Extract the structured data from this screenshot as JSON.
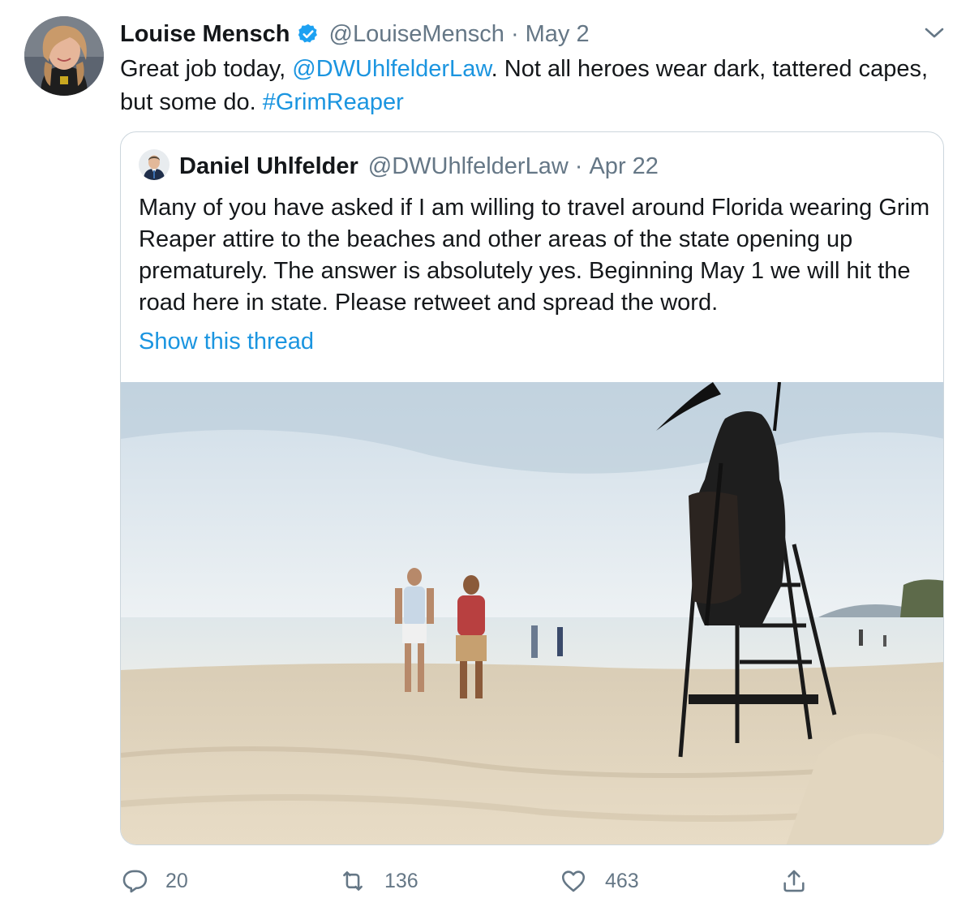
{
  "tweet": {
    "author": {
      "name": "Louise Mensch",
      "handle": "@LouiseMensch",
      "verified": true,
      "avatar_icon": "profile-photo"
    },
    "separator": "·",
    "date": "May 2",
    "text": {
      "part1": "Great job today, ",
      "mention": "@DWUhlfelderLaw",
      "part2": ". Not all heroes wear dark, tattered capes, but some do. ",
      "hashtag": "#GrimReaper"
    },
    "more_icon": "chevron-down-icon"
  },
  "quoted_tweet": {
    "author": {
      "name": "Daniel Uhlfelder",
      "handle": "@DWUhlfelderLaw",
      "avatar_icon": "profile-photo"
    },
    "separator": "·",
    "date": "Apr 22",
    "text": "Many of you have asked if I am willing to travel around Florida wearing Grim Reaper attire to the beaches and other areas of the state opening up prematurely. The answer is absolutely yes. Beginning May 1 we will hit the road here in state. Please retweet and spread the word.",
    "show_thread": "Show this thread",
    "media_icon": "beach-photo-grim-reaper"
  },
  "actions": {
    "reply": {
      "icon": "reply-icon",
      "count": "20"
    },
    "retweet": {
      "icon": "retweet-icon",
      "count": "136"
    },
    "like": {
      "icon": "heart-icon",
      "count": "463"
    },
    "share": {
      "icon": "share-icon"
    }
  },
  "colors": {
    "link": "#1b95e0",
    "text": "#14171a",
    "secondary": "#657786",
    "border": "#ccd6dd",
    "verified": "#1da1f2"
  }
}
